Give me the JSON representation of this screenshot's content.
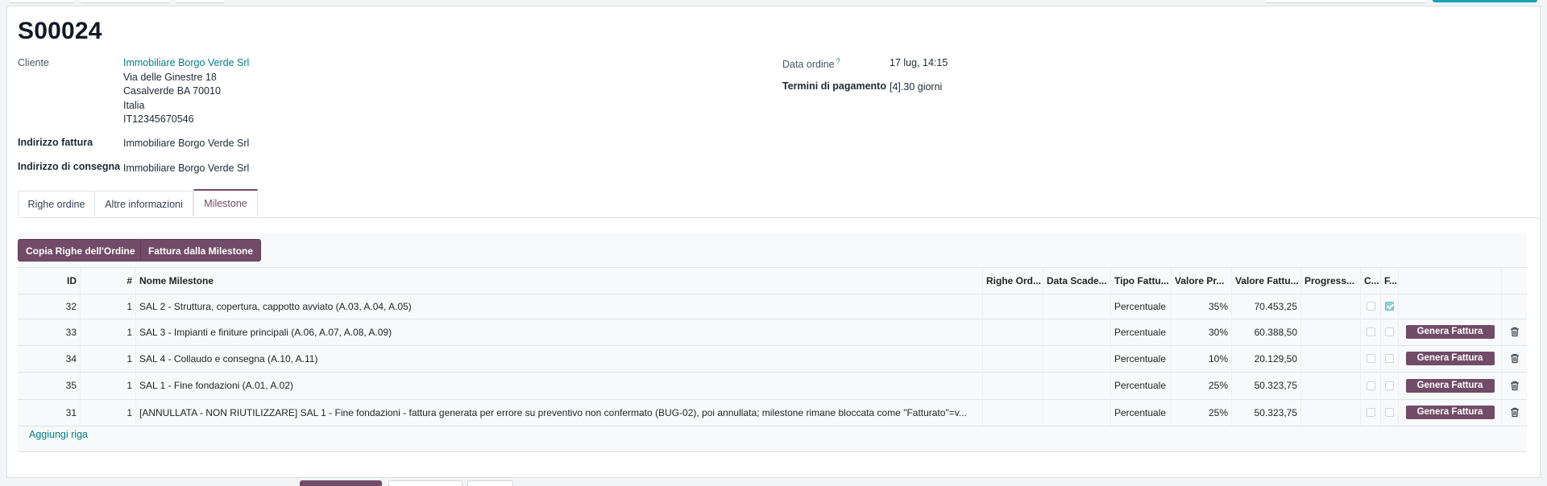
{
  "record": {
    "title": "S00024",
    "customer_label": "Cliente",
    "customer_name": "Immobiliare Borgo Verde Srl",
    "customer_street": "Via delle Ginestre 18",
    "customer_city": "Casalverde BA 70010",
    "customer_country": "Italia",
    "customer_vat": "IT12345670546",
    "invoice_address_label": "Indirizzo fattura",
    "invoice_address": "Immobiliare Borgo Verde Srl",
    "delivery_address_label": "Indirizzo di consegna",
    "delivery_address": "Immobiliare Borgo Verde Srl",
    "order_date_label": "Data ordine",
    "order_date_help": "?",
    "order_date": "17 lug, 14:15",
    "payment_terms_label": "Termini di pagamento",
    "payment_terms": "[4].30 giorni"
  },
  "tabs": [
    {
      "label": "Righe ordine",
      "active": false
    },
    {
      "label": "Altre informazioni",
      "active": false
    },
    {
      "label": "Milestone",
      "active": true
    }
  ],
  "milestone_actions": {
    "copy_lines": "Copia Righe dell'Ordine",
    "invoice_from_milestone": "Fattura dalla Milestone"
  },
  "table": {
    "headers": [
      "ID",
      "#",
      "Nome Milestone",
      "Righe Ord...",
      "Data Scade...",
      "Tipo Fattu...",
      "Valore Pr...",
      "Valore Fattu...",
      "Progress...",
      "C...",
      "F..."
    ],
    "rows": [
      {
        "id": "32",
        "seq": "1",
        "name": "SAL 2 - Struttura, copertura, cappotto avviato (A.03, A.04, A.05)",
        "type": "Percentuale",
        "pct": "35%",
        "amount": "70.453,25",
        "c": false,
        "f": true,
        "action": ""
      },
      {
        "id": "33",
        "seq": "1",
        "name": "SAL 3 - Impianti e finiture principali (A.06, A.07, A.08, A.09)",
        "type": "Percentuale",
        "pct": "30%",
        "amount": "60.388,50",
        "c": false,
        "f": false,
        "action": "Genera Fattura"
      },
      {
        "id": "34",
        "seq": "1",
        "name": "SAL 4 - Collaudo e consegna (A.10, A.11)",
        "type": "Percentuale",
        "pct": "10%",
        "amount": "20.129,50",
        "c": false,
        "f": false,
        "action": "Genera Fattura"
      },
      {
        "id": "35",
        "seq": "1",
        "name": "SAL 1 - Fine fondazioni (A.01, A.02)",
        "type": "Percentuale",
        "pct": "25%",
        "amount": "50.323,75",
        "c": false,
        "f": false,
        "action": "Genera Fattura"
      },
      {
        "id": "31",
        "seq": "1",
        "name": "[ANNULLATA - NON RIUTILIZZARE] SAL 1 - Fine fondazioni - fattura generata per errore su preventivo non confermato (BUG-02), poi annullata; milestone rimane bloccata come \"Fatturato\"=v...",
        "type": "Percentuale",
        "pct": "25%",
        "amount": "50.323,75",
        "c": false,
        "f": false,
        "action": "Genera Fattura"
      }
    ],
    "add_line": "Aggiungi riga"
  }
}
